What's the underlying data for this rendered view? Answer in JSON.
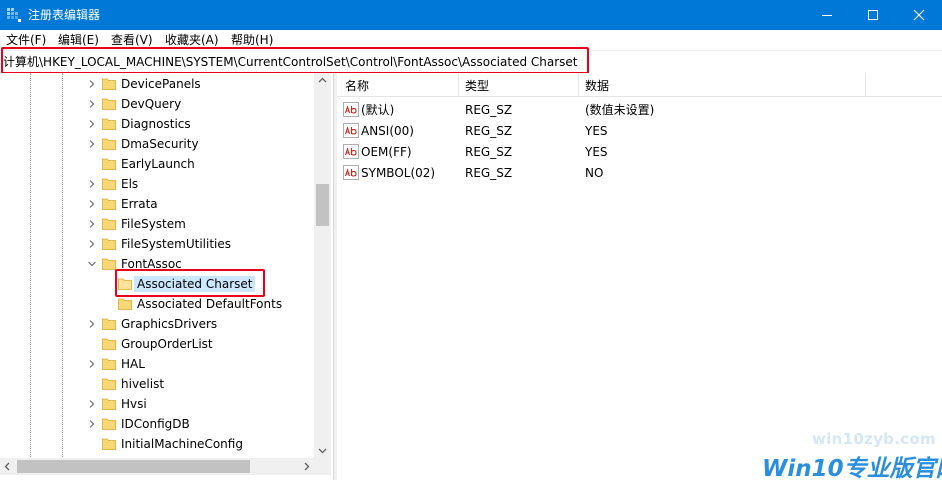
{
  "window": {
    "title": "注册表编辑器"
  },
  "menu": [
    "文件(F)",
    "编辑(E)",
    "查看(V)",
    "收藏夹(A)",
    "帮助(H)"
  ],
  "address": "计算机\\HKEY_LOCAL_MACHINE\\SYSTEM\\CurrentControlSet\\Control\\FontAssoc\\Associated Charset",
  "tree": [
    {
      "label": "DevicePanels",
      "expander": "collapsed",
      "indent": 0
    },
    {
      "label": "DevQuery",
      "expander": "collapsed",
      "indent": 0
    },
    {
      "label": "Diagnostics",
      "expander": "collapsed",
      "indent": 0
    },
    {
      "label": "DmaSecurity",
      "expander": "collapsed",
      "indent": 0
    },
    {
      "label": "EarlyLaunch",
      "expander": "none",
      "indent": 0
    },
    {
      "label": "Els",
      "expander": "collapsed",
      "indent": 0
    },
    {
      "label": "Errata",
      "expander": "collapsed",
      "indent": 0
    },
    {
      "label": "FileSystem",
      "expander": "collapsed",
      "indent": 0
    },
    {
      "label": "FileSystemUtilities",
      "expander": "collapsed",
      "indent": 0
    },
    {
      "label": "FontAssoc",
      "expander": "expanded",
      "indent": 0
    },
    {
      "label": "Associated Charset",
      "expander": "none",
      "indent": 1,
      "selected": true
    },
    {
      "label": "Associated DefaultFonts",
      "expander": "none",
      "indent": 1
    },
    {
      "label": "GraphicsDrivers",
      "expander": "collapsed",
      "indent": 0
    },
    {
      "label": "GroupOrderList",
      "expander": "none",
      "indent": 0
    },
    {
      "label": "HAL",
      "expander": "collapsed",
      "indent": 0
    },
    {
      "label": "hivelist",
      "expander": "none",
      "indent": 0
    },
    {
      "label": "Hvsi",
      "expander": "collapsed",
      "indent": 0
    },
    {
      "label": "IDConfigDB",
      "expander": "collapsed",
      "indent": 0
    },
    {
      "label": "InitialMachineConfig",
      "expander": "none",
      "indent": 0
    }
  ],
  "list": {
    "headers": {
      "name": "名称",
      "type": "类型",
      "data": "数据"
    },
    "rows": [
      {
        "name": "(默认)",
        "type": "REG_SZ",
        "data": "(数值未设置)"
      },
      {
        "name": "ANSI(00)",
        "type": "REG_SZ",
        "data": "YES"
      },
      {
        "name": "OEM(FF)",
        "type": "REG_SZ",
        "data": "YES"
      },
      {
        "name": "SYMBOL(02)",
        "type": "REG_SZ",
        "data": "NO"
      }
    ]
  },
  "icons": {
    "app": "regedit-icon",
    "folder": "folder-icon",
    "value": "string-value-icon"
  },
  "colors": {
    "titlebar": "#0078d7",
    "highlight_box": "#e8001c",
    "selection": "#cce8ff",
    "folder": "#f8d775"
  },
  "watermark": {
    "small": "win10zyb.com",
    "big": "Win10专业版官网"
  }
}
